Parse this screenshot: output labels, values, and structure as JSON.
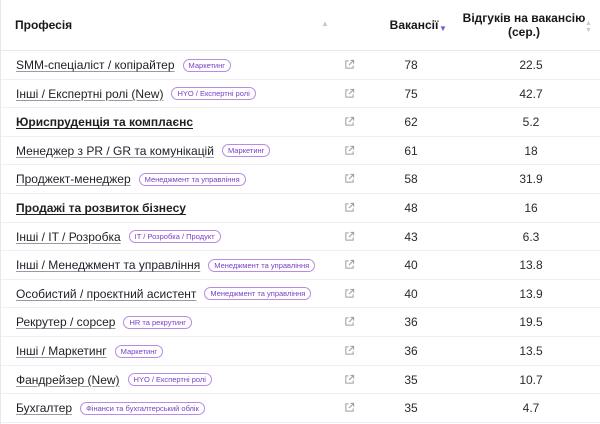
{
  "header": {
    "profession": "Професія",
    "vacancies": "Вакансії",
    "responses_line1": "Відгуків на вакансію",
    "responses_line2": "(сер.)"
  },
  "rows": [
    {
      "name": "SMM-спеціаліст / копірайтер",
      "tag": "Маркетинг",
      "bold": false,
      "vacancies": "78",
      "responses": "22.5"
    },
    {
      "name": "Інші / Експертні ролі (New)",
      "tag": "HYO / Експертні ролі",
      "bold": false,
      "vacancies": "75",
      "responses": "42.7"
    },
    {
      "name": "Юриспруденція та комплаєнс",
      "tag": "",
      "bold": true,
      "vacancies": "62",
      "responses": "5.2"
    },
    {
      "name": "Менеджер з PR / GR та комунікацій",
      "tag": "Маркетинг",
      "bold": false,
      "vacancies": "61",
      "responses": "18"
    },
    {
      "name": "Проджект-менеджер",
      "tag": "Менеджмент та управління",
      "bold": false,
      "vacancies": "58",
      "responses": "31.9"
    },
    {
      "name": "Продажі та розвиток бізнесу",
      "tag": "",
      "bold": true,
      "vacancies": "48",
      "responses": "16"
    },
    {
      "name": "Інші / IT / Розробка",
      "tag": "IT / Розробка / Продукт",
      "bold": false,
      "vacancies": "43",
      "responses": "6.3"
    },
    {
      "name": "Інші / Менеджмент та управління",
      "tag": "Менеджмент та управління",
      "bold": false,
      "vacancies": "40",
      "responses": "13.8"
    },
    {
      "name": "Особистий / проєктний асистент",
      "tag": "Менеджмент та управління",
      "bold": false,
      "vacancies": "40",
      "responses": "13.9"
    },
    {
      "name": "Рекрутер / сорсер",
      "tag": "HR та рекрутинг",
      "bold": false,
      "vacancies": "36",
      "responses": "19.5"
    },
    {
      "name": "Інші / Маркетинг",
      "tag": "Маркетинг",
      "bold": false,
      "vacancies": "36",
      "responses": "13.5"
    },
    {
      "name": "Фандрейзер (New)",
      "tag": "HYO / Експертні ролі",
      "bold": false,
      "vacancies": "35",
      "responses": "10.7"
    },
    {
      "name": "Бухгалтер",
      "tag": "Фінанси та бухгалтерський облік",
      "bold": false,
      "vacancies": "35",
      "responses": "4.7"
    }
  ],
  "icons": {
    "external_link": "external-link-icon",
    "sort": "sort-icon"
  },
  "colors": {
    "tag_text": "#7b3fc4",
    "tag_border": "#b78be6",
    "active_sort": "#6e5bd6"
  }
}
